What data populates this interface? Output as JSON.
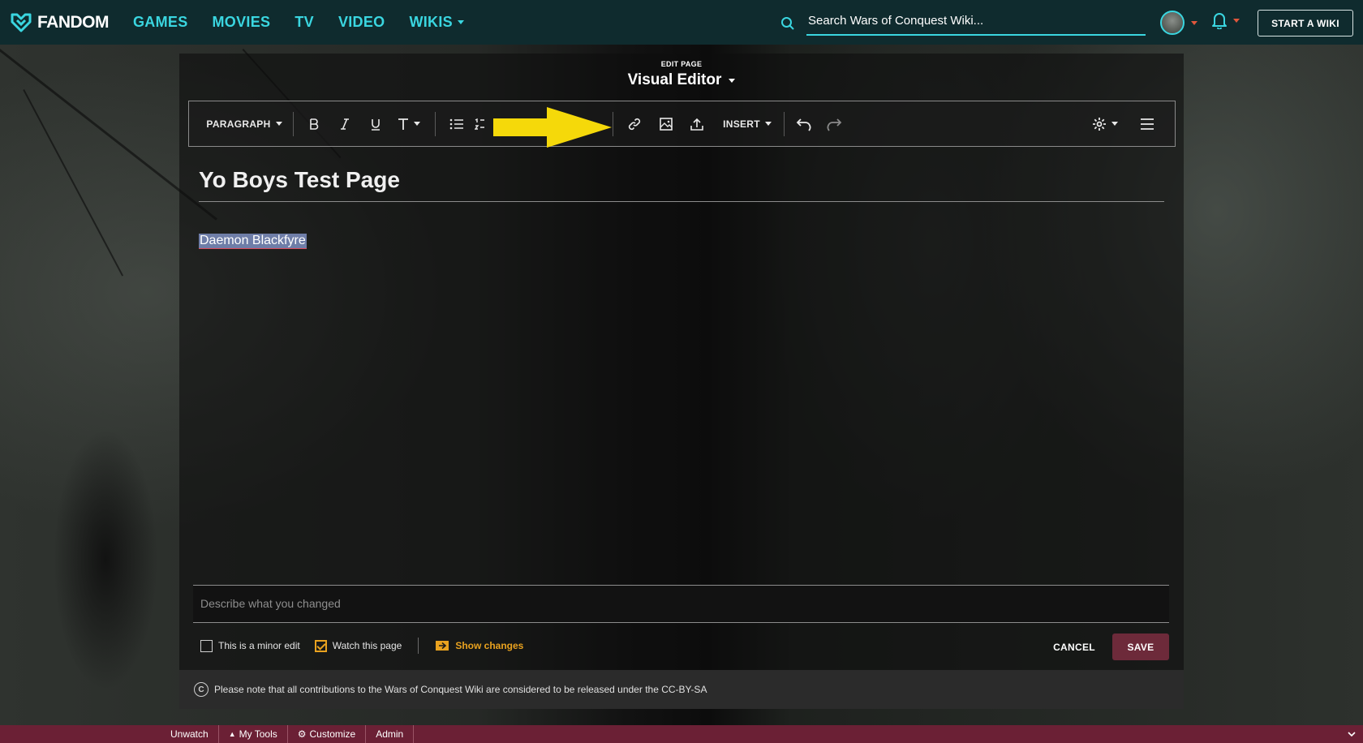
{
  "topnav": {
    "logo_text": "FANDOM",
    "links": [
      "GAMES",
      "MOVIES",
      "TV",
      "VIDEO",
      "WIKIS"
    ],
    "search_placeholder": "Search Wars of Conquest Wiki...",
    "start_wiki_label": "START A WIKI"
  },
  "editor": {
    "edit_label": "EDIT PAGE",
    "mode": "Visual Editor",
    "toolbar": {
      "paragraph": "PARAGRAPH",
      "insert": "INSERT"
    },
    "page_title": "Yo Boys Test Page",
    "body_text": "Daemon Blackfyre",
    "summary_placeholder": "Describe what you changed",
    "minor_edit_label": "This is a minor edit",
    "watch_label": "Watch this page",
    "show_changes_label": "Show changes",
    "cancel_label": "CANCEL",
    "save_label": "SAVE",
    "license_text": "Please note that all contributions to the Wars of Conquest Wiki are considered to be released under the CC-BY-SA"
  },
  "bottom_bar": {
    "items": [
      "Unwatch",
      "My Tools",
      "Customize",
      "Admin"
    ]
  },
  "colors": {
    "nav_bg": "#0f2b2e",
    "nav_link": "#3ad6e0",
    "accent_orange": "#e9a21f",
    "save_bg": "#6d2a3a",
    "bottom_bar": "#6b2035",
    "annotation_arrow": "#f5d90a"
  },
  "icons": [
    "fandom-heart-icon",
    "search-icon",
    "bell-icon",
    "bold-icon",
    "italic-icon",
    "underline-icon",
    "text-style-icon",
    "bullet-list-icon",
    "numbered-list-icon",
    "link-icon",
    "image-icon",
    "upload-icon",
    "undo-icon",
    "redo-icon",
    "gear-icon",
    "menu-icon",
    "show-changes-icon",
    "cc-icon",
    "chevron-down-icon"
  ]
}
